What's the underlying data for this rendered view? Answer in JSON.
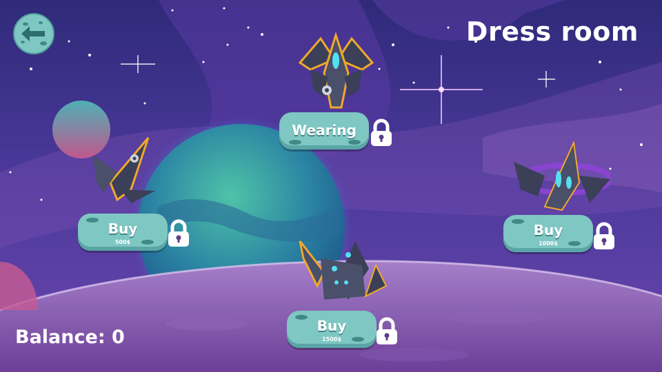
{
  "header": {
    "title": "Dress room"
  },
  "footer": {
    "balance_label": "Balance:",
    "balance_value": "0"
  },
  "back_button": {
    "icon": "arrow-left-icon"
  },
  "ships": [
    {
      "id": "top",
      "button_label": "Wearing",
      "price": "",
      "locked": true
    },
    {
      "id": "left",
      "button_label": "Buy",
      "price": "500$",
      "locked": true
    },
    {
      "id": "right",
      "button_label": "Buy",
      "price": "1000$",
      "locked": true
    },
    {
      "id": "bottom",
      "button_label": "Buy",
      "price": "1500$",
      "locked": true
    }
  ],
  "colors": {
    "sky_top": "#3a2f86",
    "sky_mid": "#5b3fa5",
    "ground": "#8a5fb0",
    "button": "#7fc7c3",
    "ship_dark": "#3b3f57",
    "ship_accent": "#f0a92a",
    "ship_glow": "#53e0f0"
  }
}
